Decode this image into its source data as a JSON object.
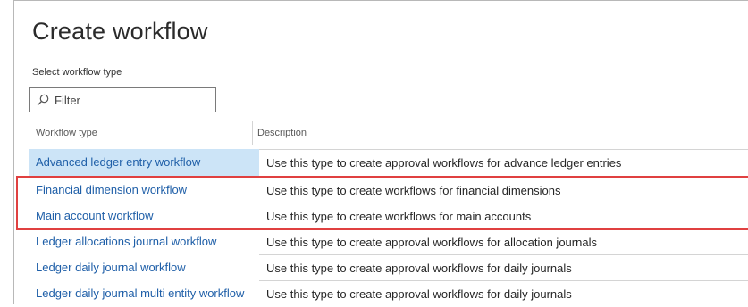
{
  "page": {
    "title": "Create workflow",
    "select_label": "Select workflow type"
  },
  "filter": {
    "placeholder": "Filter",
    "icon": "search-icon"
  },
  "table": {
    "columns": [
      "Workflow type",
      "Description"
    ],
    "rows": [
      {
        "type": "Advanced ledger entry workflow",
        "description": "Use this type to create approval workflows for advance ledger entries",
        "selected": true
      },
      {
        "type": "Financial dimension workflow",
        "description": "Use this type to create workflows for financial dimensions",
        "highlighted": true
      },
      {
        "type": "Main account workflow",
        "description": "Use this type to create workflows for main accounts",
        "highlighted": true
      },
      {
        "type": "Ledger allocations journal workflow",
        "description": "Use this type to create approval workflows for allocation journals"
      },
      {
        "type": "Ledger daily journal workflow",
        "description": "Use this type to create approval workflows for daily journals"
      },
      {
        "type": "Ledger daily journal multi entity workflow",
        "description": "Use this type to create approval workflows for daily journals"
      }
    ]
  },
  "colors": {
    "link": "#1f5fa8",
    "selected_row": "#cce4f7",
    "highlight_border": "#e04040"
  }
}
